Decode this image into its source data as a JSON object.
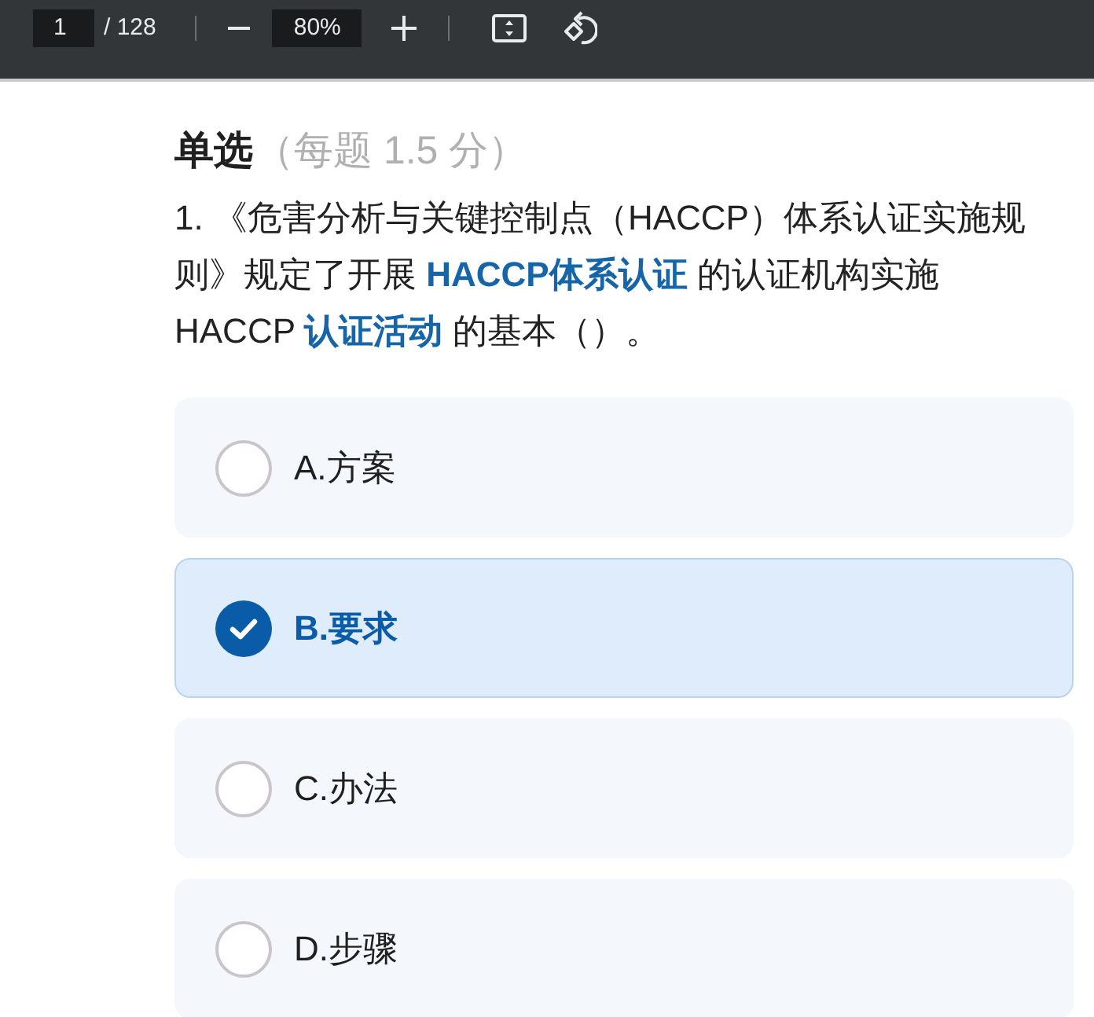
{
  "toolbar": {
    "page_number": "1",
    "page_total": "/ 128",
    "zoom_level": "80%"
  },
  "section": {
    "title": "单选",
    "score_note": "（每题 1.5 分）"
  },
  "question": {
    "text": "1. 《危害分析与关键控制点（HACCP）体系认证实施规则》规定了开展 **HACCP体系认证** 的认证机构实施 HACCP **认证活动** 的基本（）。"
  },
  "options": [
    {
      "label": "A.方案",
      "selected": false
    },
    {
      "label": "B.要求",
      "selected": true
    },
    {
      "label": "C.办法",
      "selected": false
    },
    {
      "label": "D.步骤",
      "selected": false
    }
  ]
}
